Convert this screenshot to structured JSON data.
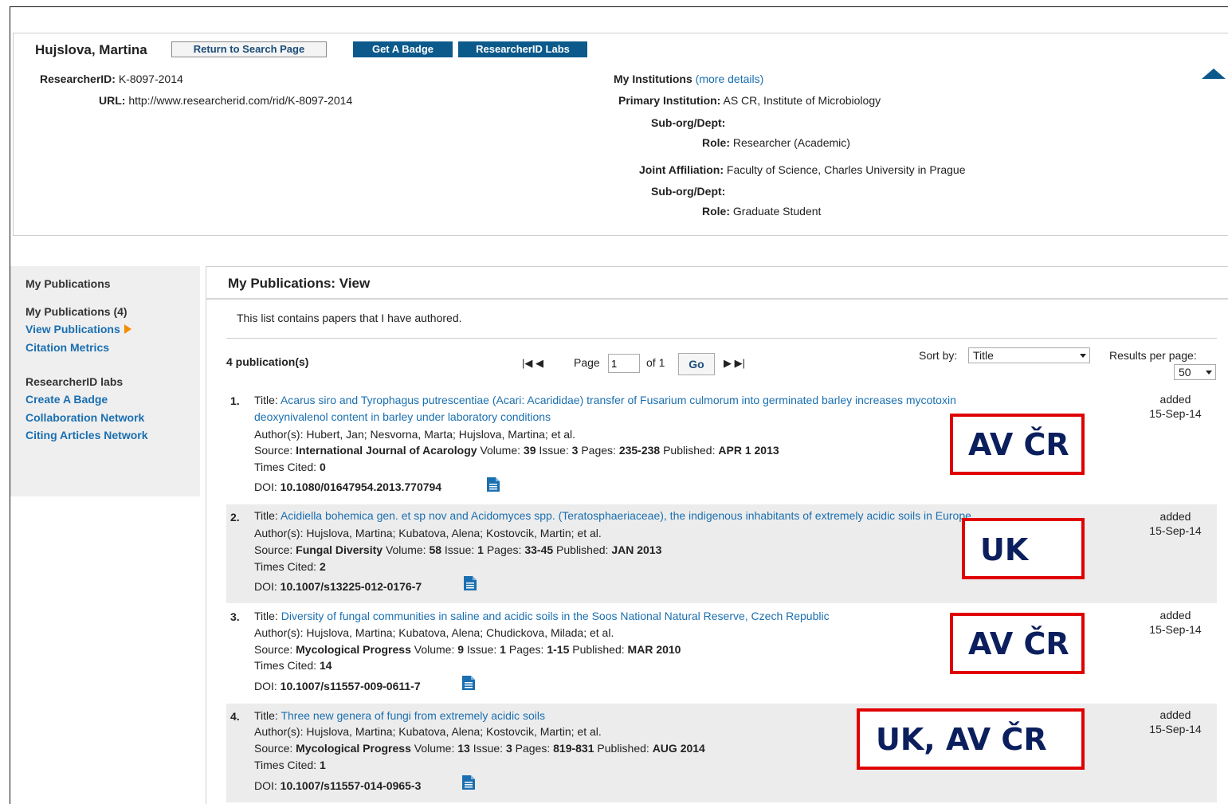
{
  "profile": {
    "name": "Hujslova, Martina",
    "buttons": {
      "return": "Return to Search Page",
      "badge": "Get A Badge",
      "labs": "ResearcherID Labs"
    },
    "researcher_id_label": "ResearcherID:",
    "researcher_id": "K-8097-2014",
    "url_label": "URL:",
    "url": "http://www.researcherid.com/rid/K-8097-2014",
    "institutions_label": "My Institutions",
    "more_details": "(more details)",
    "primary_label": "Primary Institution:",
    "primary": "AS CR, Institute of Microbiology",
    "suborg_label": "Sub-org/Dept:",
    "role_label": "Role:",
    "primary_role": "Researcher (Academic)",
    "joint_label": "Joint Affiliation:",
    "joint": "Faculty of Science, Charles University in Prague",
    "joint_role": "Graduate Student"
  },
  "sidebar": {
    "heading": "My Publications",
    "my_pubs": "My Publications (4)",
    "view_pubs": "View Publications",
    "citation_metrics": "Citation Metrics",
    "labs_heading": "ResearcherID labs",
    "create_badge": "Create A Badge",
    "collab_network": "Collaboration Network",
    "citing_network": "Citing Articles Network"
  },
  "main": {
    "title": "My Publications: View",
    "intro": "This list contains papers that I have authored.",
    "count": "4 publication(s)",
    "pager": {
      "first_prev": "|◀ ◀",
      "page_label": "Page",
      "page_value": "1",
      "of_label": "of",
      "total": "1",
      "go": "Go",
      "next_last": "▶ ▶|"
    },
    "sort_label": "Sort by:",
    "sort_value": "Title",
    "rpp_label": "Results per page:",
    "rpp_value": "50"
  },
  "labels": {
    "title": "Title:",
    "authors": "Author(s):",
    "source": "Source:",
    "volume": "Volume:",
    "issue": "Issue:",
    "pages": "Pages:",
    "published": "Published:",
    "times_cited": "Times Cited:",
    "doi": "DOI:",
    "added": "added"
  },
  "publications": [
    {
      "num": "1.",
      "title_line1": "Acarus siro and Tyrophagus putrescentiae (Acari: Acarididae) transfer of Fusarium culmorum into germinated barley increases mycotoxin",
      "title_line2": "deoxynivalenol content in barley under laboratory conditions",
      "authors": "Hubert, Jan; Nesvorna, Marta; Hujslova, Martina; et al.",
      "journal": "International Journal of Acarology",
      "volume": "39",
      "issue": "3",
      "pages": "235-238",
      "published": "APR 1 2013",
      "times_cited": "0",
      "doi": "10.1080/01647954.2013.770794",
      "added": "15-Sep-14",
      "annotation": "AV ČR"
    },
    {
      "num": "2.",
      "title_line1": "Acidiella bohemica gen. et sp nov and Acidomyces spp. (Teratosphaeriaceae), the indigenous inhabitants of extremely acidic soils in Europe",
      "authors": "Hujslova, Martina; Kubatova, Alena; Kostovcik, Martin; et al.",
      "journal": "Fungal Diversity",
      "volume": "58",
      "issue": "1",
      "pages": "33-45",
      "published": "JAN 2013",
      "times_cited": "2",
      "doi": "10.1007/s13225-012-0176-7",
      "added": "15-Sep-14",
      "annotation": "UK"
    },
    {
      "num": "3.",
      "title_line1": "Diversity of fungal communities in saline and acidic soils in the Soos National Natural Reserve, Czech Republic",
      "authors": "Hujslova, Martina; Kubatova, Alena; Chudickova, Milada; et al.",
      "journal": "Mycological Progress",
      "volume": "9",
      "issue": "1",
      "pages": "1-15",
      "published": "MAR 2010",
      "times_cited": "14",
      "doi": "10.1007/s11557-009-0611-7",
      "added": "15-Sep-14",
      "annotation": "AV ČR"
    },
    {
      "num": "4.",
      "title_line1": "Three new genera of fungi from extremely acidic soils",
      "authors": "Hujslova, Martina; Kubatova, Alena; Kostovcik, Martin; et al.",
      "journal": "Mycological Progress",
      "volume": "13",
      "issue": "3",
      "pages": "819-831",
      "published": "AUG 2014",
      "times_cited": "1",
      "doi": "10.1007/s11557-014-0965-3",
      "added": "15-Sep-14",
      "annotation": "UK, AV ČR"
    }
  ],
  "colors": {
    "link": "#1a6fb0",
    "button_blue": "#0c5a8c",
    "annotation_border": "#e00000",
    "annotation_text": "#0b1f5e",
    "accent_arrow": "#f28c00"
  }
}
